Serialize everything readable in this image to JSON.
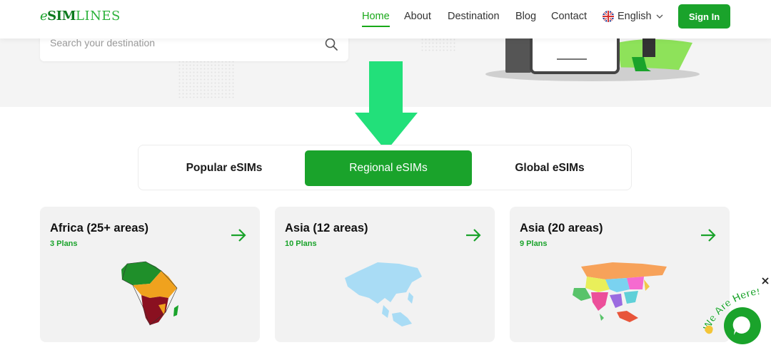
{
  "header": {
    "logo": {
      "e": "e",
      "sim": "SIM",
      "lines": "LINES"
    },
    "nav": [
      "Home",
      "About",
      "Destination",
      "Blog",
      "Contact"
    ],
    "active_nav": "Home",
    "language": "English",
    "signin_label": "Sign In"
  },
  "hero": {
    "search_placeholder": "Search your destination"
  },
  "tabs": [
    "Popular eSIMs",
    "Regional eSIMs",
    "Global eSIMs"
  ],
  "active_tab": "Regional eSIMs",
  "cards": [
    {
      "title": "Africa (25+ areas)",
      "plans": "3 Plans",
      "map": "africa-map"
    },
    {
      "title": "Asia (12 areas)",
      "plans": "10 Plans",
      "map": "asia-map"
    },
    {
      "title": "Asia (20 areas)",
      "plans": "9 Plans",
      "map": "asia-color-map"
    }
  ],
  "chat": {
    "label": "We Are Here!"
  },
  "colors": {
    "accent": "#1aa32b",
    "arrow": "#22e07a",
    "card_bg": "#f2f2f2"
  }
}
